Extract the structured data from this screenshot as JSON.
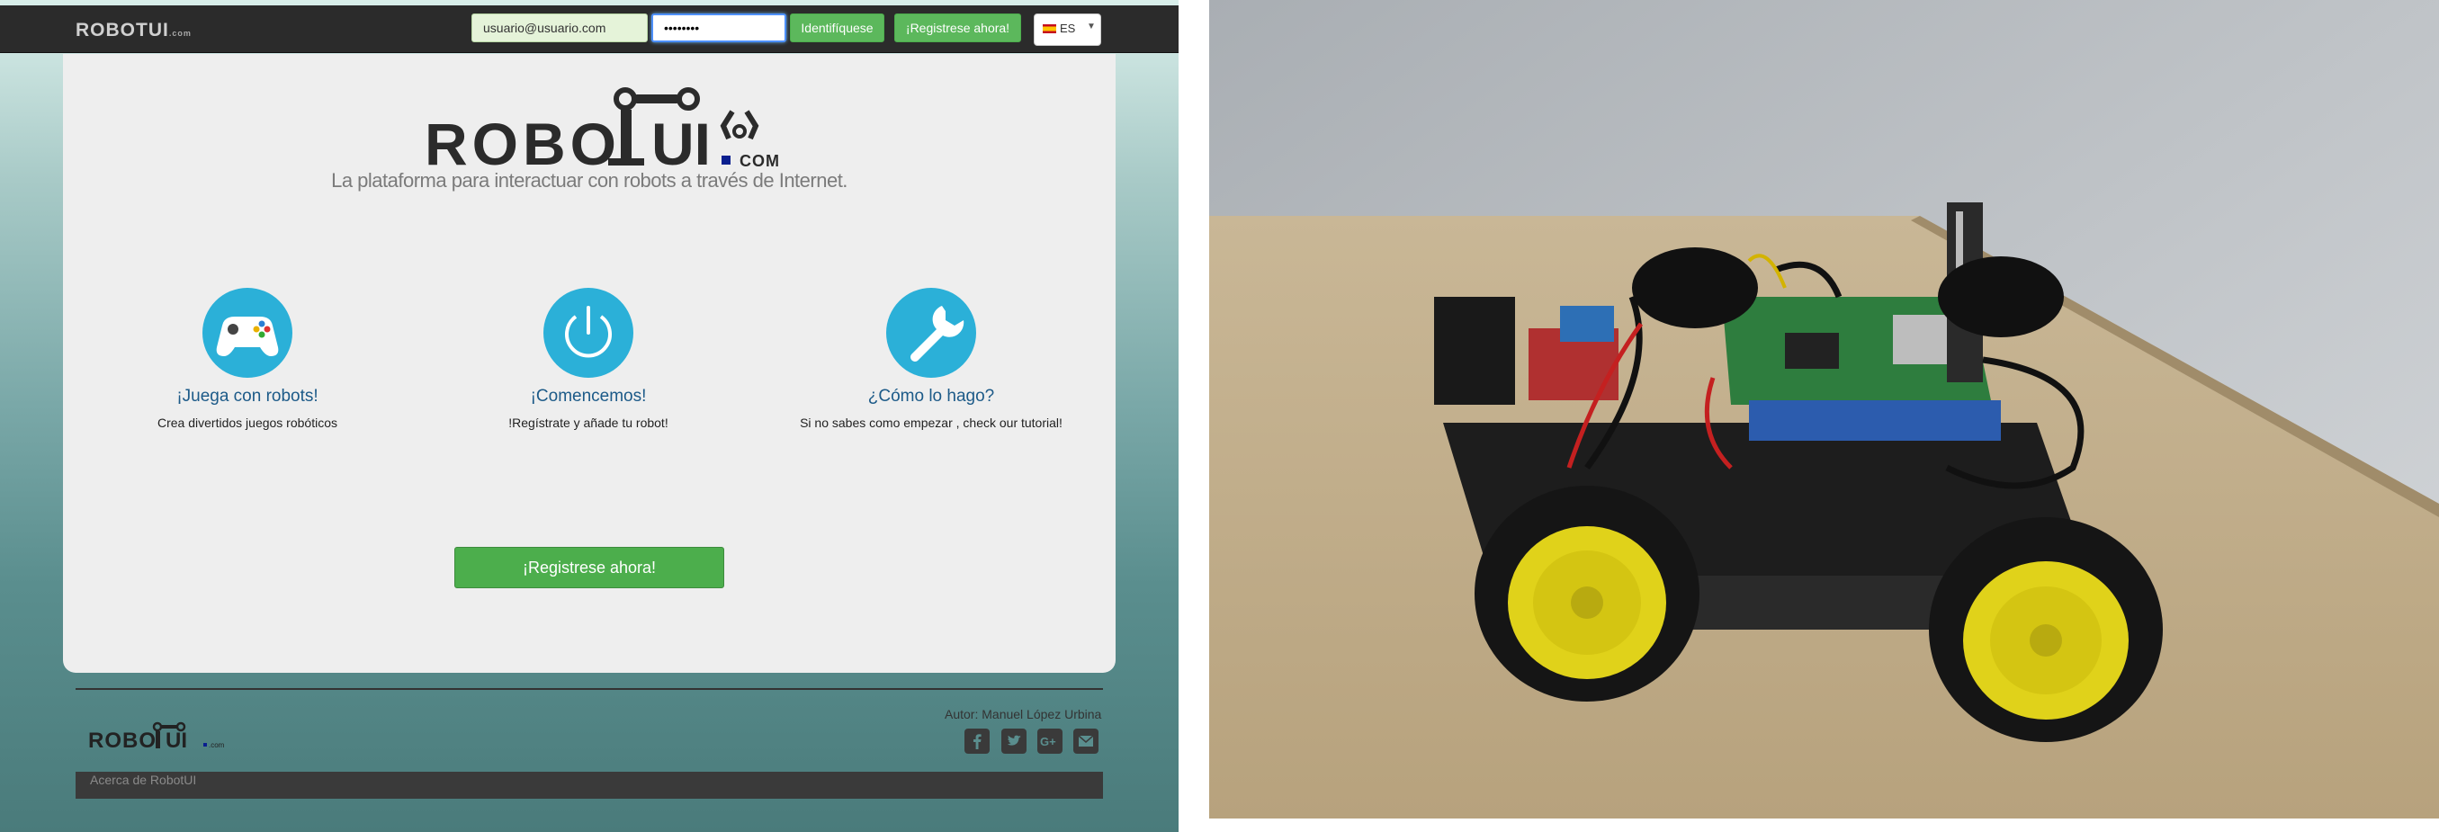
{
  "nav": {
    "brand": "ROBOTUI",
    "brand_suffix": ".com",
    "email_value": "usuario@usuario.com",
    "password_value": "••••••••",
    "login_label": "Identifíquese",
    "register_label": "¡Registrese ahora!",
    "language": "ES"
  },
  "hero": {
    "logo_text": "ROBOTUI",
    "logo_suffix": "COM",
    "tagline": "La plataforma para interactuar con robots a través de Internet."
  },
  "features": [
    {
      "icon": "gamepad-icon",
      "title": "¡Juega con robots!",
      "desc": "Crea divertidos juegos robóticos"
    },
    {
      "icon": "power-icon",
      "title": "¡Comencemos!",
      "desc": "!Regístrate y añade tu robot!"
    },
    {
      "icon": "wrench-icon",
      "title": "¿Cómo lo hago?",
      "desc": "Si no sabes como empezar , check our tutorial!"
    }
  ],
  "cta_label": "¡Registrese ahora!",
  "footer": {
    "logo_text": "ROBOTUI",
    "logo_suffix": ".com",
    "author": "Autor: Manuel López Urbina",
    "social": [
      "facebook-icon",
      "twitter-icon",
      "google-plus-icon",
      "mail-icon"
    ],
    "about": "Acerca de RobotUI"
  },
  "colors": {
    "accent_green": "#5cb85c",
    "feature_blue": "#2bb0d8",
    "title_blue": "#1c5a88",
    "navbar": "#2b2b2b"
  }
}
